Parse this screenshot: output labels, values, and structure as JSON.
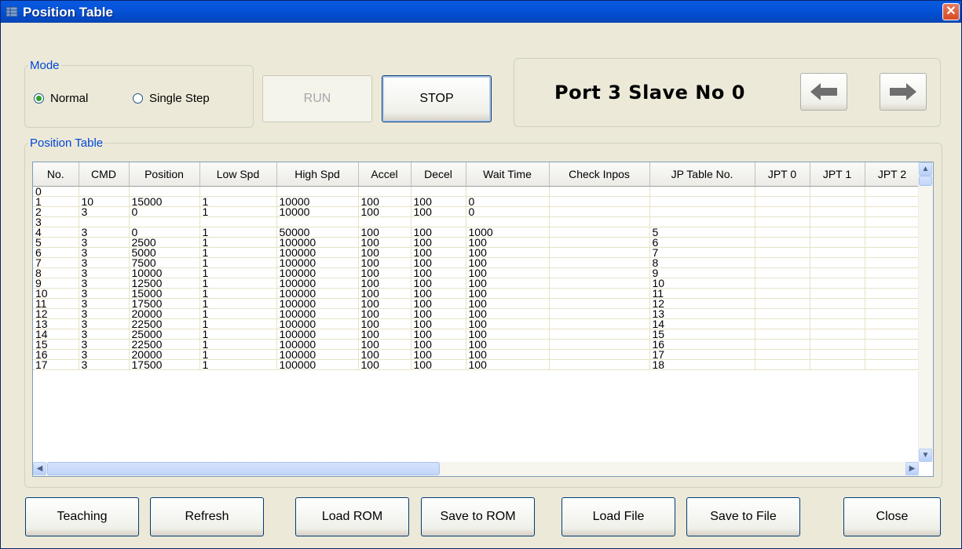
{
  "window": {
    "title": "Position Table",
    "close_glyph": "✕"
  },
  "mode": {
    "legend": "Mode",
    "options": [
      {
        "label": "Normal",
        "checked": true
      },
      {
        "label": "Single Step",
        "checked": false
      }
    ]
  },
  "controls": {
    "run_label": "RUN",
    "stop_label": "STOP"
  },
  "port": {
    "label": "Port 3 Slave No 0"
  },
  "table": {
    "legend": "Position Table",
    "columns": [
      "No.",
      "CMD",
      "Position",
      "Low Spd",
      "High Spd",
      "Accel",
      "Decel",
      "Wait Time",
      "Check Inpos",
      "JP Table No.",
      "JPT 0",
      "JPT 1",
      "JPT 2"
    ],
    "rows": [
      [
        "0",
        "",
        "",
        "",
        "",
        "",
        "",
        "",
        "",
        "",
        "",
        "",
        ""
      ],
      [
        "1",
        "10",
        "15000",
        "1",
        "10000",
        "100",
        "100",
        "0",
        "",
        "",
        "",
        "",
        ""
      ],
      [
        "2",
        "3",
        "0",
        "1",
        "10000",
        "100",
        "100",
        "0",
        "",
        "",
        "",
        "",
        ""
      ],
      [
        "3",
        "",
        "",
        "",
        "",
        "",
        "",
        "",
        "",
        "",
        "",
        "",
        ""
      ],
      [
        "4",
        "3",
        "0",
        "1",
        "50000",
        "100",
        "100",
        "1000",
        "",
        "5",
        "",
        "",
        ""
      ],
      [
        "5",
        "3",
        "2500",
        "1",
        "100000",
        "100",
        "100",
        "100",
        "",
        "6",
        "",
        "",
        ""
      ],
      [
        "6",
        "3",
        "5000",
        "1",
        "100000",
        "100",
        "100",
        "100",
        "",
        "7",
        "",
        "",
        ""
      ],
      [
        "7",
        "3",
        "7500",
        "1",
        "100000",
        "100",
        "100",
        "100",
        "",
        "8",
        "",
        "",
        ""
      ],
      [
        "8",
        "3",
        "10000",
        "1",
        "100000",
        "100",
        "100",
        "100",
        "",
        "9",
        "",
        "",
        ""
      ],
      [
        "9",
        "3",
        "12500",
        "1",
        "100000",
        "100",
        "100",
        "100",
        "",
        "10",
        "",
        "",
        ""
      ],
      [
        "10",
        "3",
        "15000",
        "1",
        "100000",
        "100",
        "100",
        "100",
        "",
        "11",
        "",
        "",
        ""
      ],
      [
        "11",
        "3",
        "17500",
        "1",
        "100000",
        "100",
        "100",
        "100",
        "",
        "12",
        "",
        "",
        ""
      ],
      [
        "12",
        "3",
        "20000",
        "1",
        "100000",
        "100",
        "100",
        "100",
        "",
        "13",
        "",
        "",
        ""
      ],
      [
        "13",
        "3",
        "22500",
        "1",
        "100000",
        "100",
        "100",
        "100",
        "",
        "14",
        "",
        "",
        ""
      ],
      [
        "14",
        "3",
        "25000",
        "1",
        "100000",
        "100",
        "100",
        "100",
        "",
        "15",
        "",
        "",
        ""
      ],
      [
        "15",
        "3",
        "22500",
        "1",
        "100000",
        "100",
        "100",
        "100",
        "",
        "16",
        "",
        "",
        ""
      ],
      [
        "16",
        "3",
        "20000",
        "1",
        "100000",
        "100",
        "100",
        "100",
        "",
        "17",
        "",
        "",
        ""
      ],
      [
        "17",
        "3",
        "17500",
        "1",
        "100000",
        "100",
        "100",
        "100",
        "",
        "18",
        "",
        "",
        ""
      ]
    ]
  },
  "buttons": {
    "teaching": "Teaching",
    "refresh": "Refresh",
    "load_rom": "Load ROM",
    "save_rom": "Save to ROM",
    "load_file": "Load File",
    "save_file": "Save to File",
    "close": "Close"
  }
}
